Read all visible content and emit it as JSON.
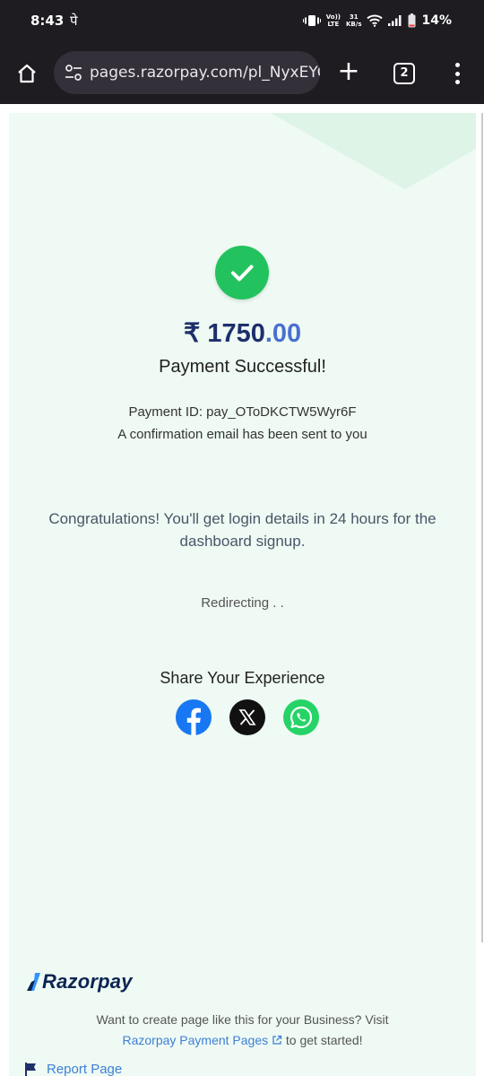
{
  "status_bar": {
    "time": "8:43",
    "extra_glyph": "पे",
    "net_top": "Vo))",
    "net_bottom": "LTE",
    "speed_top": "31",
    "speed_bottom": "KB/s",
    "battery": "14%"
  },
  "browser": {
    "url": "pages.razorpay.com/pl_NyxEYCc",
    "tab_count": "2",
    "new_tab": "+"
  },
  "payment": {
    "currency_symbol": "₹ ",
    "amount_int": "1750",
    "amount_dec": ".00",
    "status": "Payment Successful!",
    "payment_id": "Payment ID: pay_OToDKCTW5Wyr6F",
    "confirmation": "A confirmation email has been sent to you"
  },
  "message": {
    "congrats": "Congratulations! You'll get login details in 24 hours for the dashboard signup.",
    "redirect": "Redirecting . ."
  },
  "share": {
    "title": "Share Your Experience",
    "icons": [
      "facebook-icon",
      "x-icon",
      "whatsapp-icon"
    ]
  },
  "footer": {
    "brand": "Razorpay",
    "promo_line1": "Want to create page like this for your Business? Visit",
    "promo_link": "Razorpay Payment Pages",
    "promo_suffix": " to get started!",
    "report": "Report Page"
  },
  "colors": {
    "page_bg": "#eefaf3",
    "success": "#22c35e",
    "amount": "#1e2f6b",
    "link": "#3f7fd6"
  }
}
